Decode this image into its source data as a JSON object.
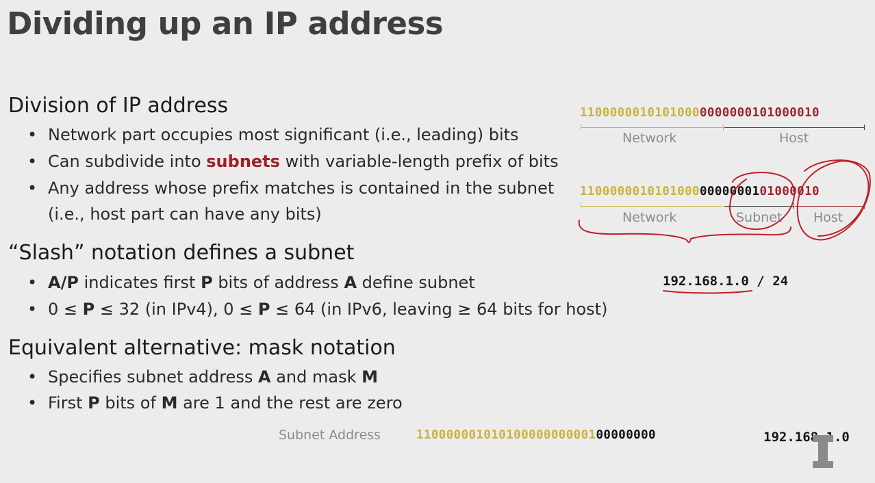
{
  "title": "Dividing up an IP address",
  "sections": {
    "division": {
      "heading": "Division of IP address",
      "b1": "Network part occupies most significant (i.e., leading) bits",
      "b2_pre": "Can subdivide into ",
      "b2_bold": "subnets",
      "b2_post": " with variable-length prefix of bits",
      "b3_l1": "Any address whose prefix matches is contained in the subnet",
      "b3_l2": "(i.e., host part can have any bits)"
    },
    "slash": {
      "heading": "“Slash” notation defines a subnet",
      "b1_a": "A/P",
      "b1_b": " indicates first ",
      "b1_c": "P",
      "b1_d": " bits of address ",
      "b1_e": "A",
      "b1_f": " define subnet",
      "b2_a": "0 ≤ ",
      "b2_b": "P",
      "b2_c": " ≤ 32 (in IPv4),  0 ≤ ",
      "b2_d": "P",
      "b2_e": " ≤ 64 (in IPv6, leaving ≥ 64 bits for host)"
    },
    "mask": {
      "heading": "Equivalent alternative: mask notation",
      "b1_a": "Specifies subnet address ",
      "b1_b": "A",
      "b1_c": " and mask ",
      "b1_d": "M",
      "b2_a": "First ",
      "b2_b": "P",
      "b2_c": " bits of ",
      "b2_d": "M",
      "b2_e": " are 1 and the rest are zero"
    }
  },
  "diagram": {
    "row1": {
      "network_bits": "1100000010101000",
      "host_bits": "0000000101000010",
      "network_label": "Network",
      "host_label": "Host"
    },
    "row2": {
      "network_bits": "1100000010101000",
      "subnet_bits": "00000001",
      "host_bits": "01000010",
      "network_label": "Network",
      "subnet_label": "Subnet",
      "host_label": "Host"
    },
    "slash_example": {
      "address": "192.168.1.0",
      "separator": "/",
      "prefix": "24"
    }
  },
  "subnet_address_row": {
    "label": "Subnet Address",
    "prefix_bits": "110000001010100000000001",
    "zero_bits": "00000000",
    "dotted": "192.168.1.0"
  },
  "colors": {
    "network": "#c9b43c",
    "host": "#9c2430",
    "ink": "#c0202a",
    "emphasis": "#a31d2a"
  },
  "icons": {
    "logo": "block-i-logo"
  }
}
